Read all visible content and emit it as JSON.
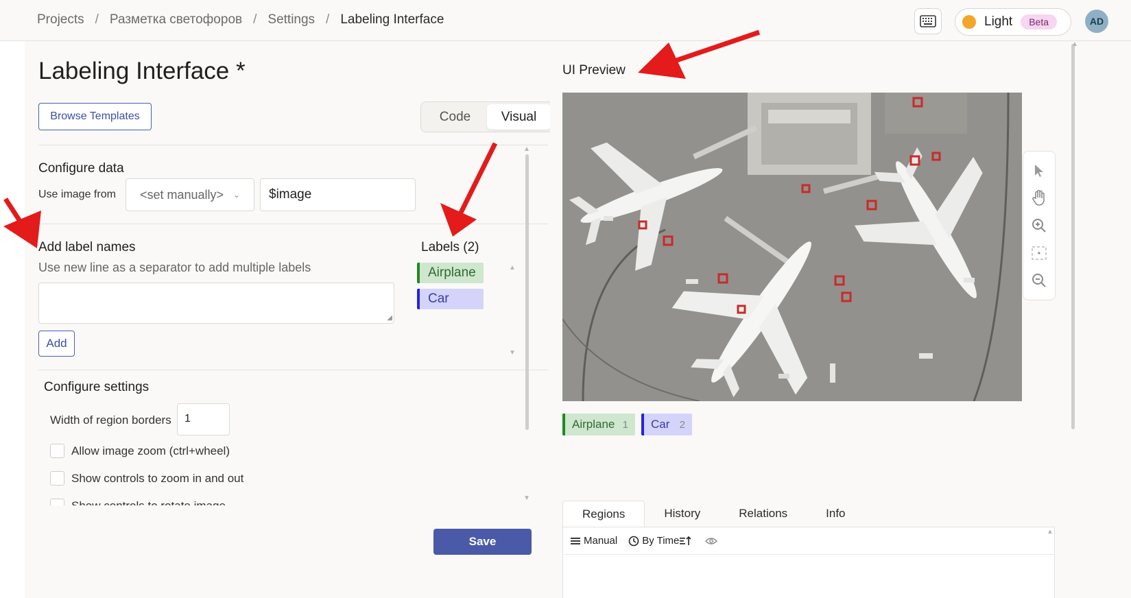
{
  "breadcrumb": {
    "items": [
      "Projects",
      "Разметка светофоров",
      "Settings",
      "Labeling Interface"
    ],
    "separator": "/"
  },
  "header": {
    "theme_label": "Light",
    "beta_label": "Beta",
    "avatar_initials": "AD"
  },
  "left": {
    "title": "Labeling Interface *",
    "browse_templates": "Browse Templates",
    "mode_tabs": [
      "Code",
      "Visual"
    ],
    "active_mode": "Visual",
    "configure_data": {
      "title": "Configure data",
      "use_image_from_label": "Use image from",
      "select_value": "<set manually>",
      "input_value": "$image"
    },
    "add_labels": {
      "title": "Add label names",
      "hint": "Use new line as a separator to add multiple labels",
      "textarea_value": "",
      "add_button": "Add"
    },
    "labels_list": {
      "title": "Labels (2)",
      "items": [
        {
          "name": "Airplane",
          "color": "#1f8a1f"
        },
        {
          "name": "Car",
          "color": "#2222e0"
        }
      ]
    },
    "configure_settings": {
      "title": "Configure settings",
      "width_label": "Width of region borders",
      "width_value": "1",
      "checkboxes": [
        {
          "label": "Allow image zoom (ctrl+wheel)",
          "checked": false
        },
        {
          "label": "Show controls to zoom in and out",
          "checked": false
        },
        {
          "label": "Show controls to rotate image",
          "checked": false
        }
      ]
    },
    "save_button": "Save"
  },
  "right": {
    "title": "UI Preview",
    "preview_labels": [
      {
        "name": "Airplane",
        "hotkey": "1",
        "color": "#1f8a1f"
      },
      {
        "name": "Car",
        "hotkey": "2",
        "color": "#2222e0"
      }
    ],
    "tools": [
      "pointer-icon",
      "hand-pan-icon",
      "zoom-in-icon",
      "fit-screen-icon",
      "zoom-out-icon"
    ],
    "tabs": [
      "Regions",
      "History",
      "Relations",
      "Info"
    ],
    "active_tab": "Regions",
    "regions_toolbar": {
      "manual": "Manual",
      "by_time": "By Time"
    }
  },
  "colors": {
    "accent": "#4a5aa8",
    "annotation_arrow": "#e31b1b"
  }
}
